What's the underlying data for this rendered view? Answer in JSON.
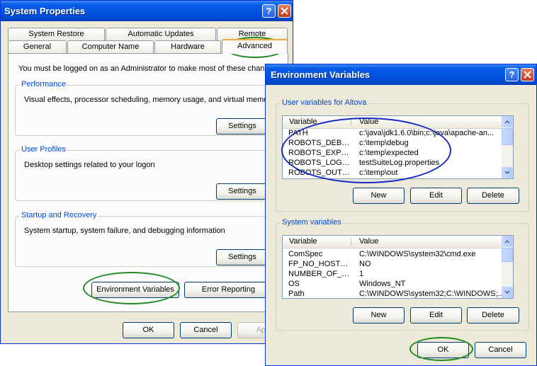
{
  "system_properties": {
    "title": "System Properties",
    "tabs_back": [
      "System Restore",
      "Automatic Updates",
      "Remote"
    ],
    "tabs_front": [
      "General",
      "Computer Name",
      "Hardware",
      "Advanced"
    ],
    "admin_notice": "You must be logged on as an Administrator to make most of these change",
    "performance": {
      "legend": "Performance",
      "description": "Visual effects, processor scheduling, memory usage, and virtual memory",
      "settings_label": "Settings"
    },
    "user_profiles": {
      "legend": "User Profiles",
      "description": "Desktop settings related to your logon",
      "settings_label": "Settings"
    },
    "startup_recovery": {
      "legend": "Startup and Recovery",
      "description": "System startup, system failure, and debugging information",
      "settings_label": "Settings"
    },
    "env_vars_label": "Environment Variables",
    "error_reporting_label": "Error Reporting",
    "ok_label": "OK",
    "cancel_label": "Cancel",
    "apply_label": "App"
  },
  "environment_variables": {
    "title": "Environment Variables",
    "user_group": {
      "legend": "User variables for Altova",
      "col_variable": "Variable",
      "col_value": "Value",
      "rows": [
        {
          "variable": "PATH",
          "value": "c:\\java\\jdk1.6.0\\bin;c:\\java\\apache-an..."
        },
        {
          "variable": "ROBOTS_DEBU...",
          "value": "c:\\temp\\debug"
        },
        {
          "variable": "ROBOTS_EXPEC...",
          "value": "c:\\temp\\expected"
        },
        {
          "variable": "ROBOTS_LOGGI...",
          "value": "testSuiteLog.properties"
        },
        {
          "variable": "ROBOTS_OUT_...",
          "value": "c:\\temp\\out"
        }
      ],
      "new_label": "New",
      "edit_label": "Edit",
      "delete_label": "Delete"
    },
    "system_group": {
      "legend": "System variables",
      "col_variable": "Variable",
      "col_value": "Value",
      "rows": [
        {
          "variable": "ComSpec",
          "value": "C:\\WINDOWS\\system32\\cmd.exe"
        },
        {
          "variable": "FP_NO_HOST_C...",
          "value": "NO"
        },
        {
          "variable": "NUMBER_OF_P...",
          "value": "1"
        },
        {
          "variable": "OS",
          "value": "Windows_NT"
        },
        {
          "variable": "Path",
          "value": "C:\\WINDOWS\\system32;C:\\WINDOWS;..."
        }
      ],
      "new_label": "New",
      "edit_label": "Edit",
      "delete_label": "Delete"
    },
    "ok_label": "OK",
    "cancel_label": "Cancel"
  },
  "colors": {
    "titlebar": "#0054e3",
    "dialog_face": "#ece9d8",
    "group_legend": "#0046d5",
    "annotation_green": "#1f8a1f",
    "annotation_blue": "#1428c8"
  }
}
